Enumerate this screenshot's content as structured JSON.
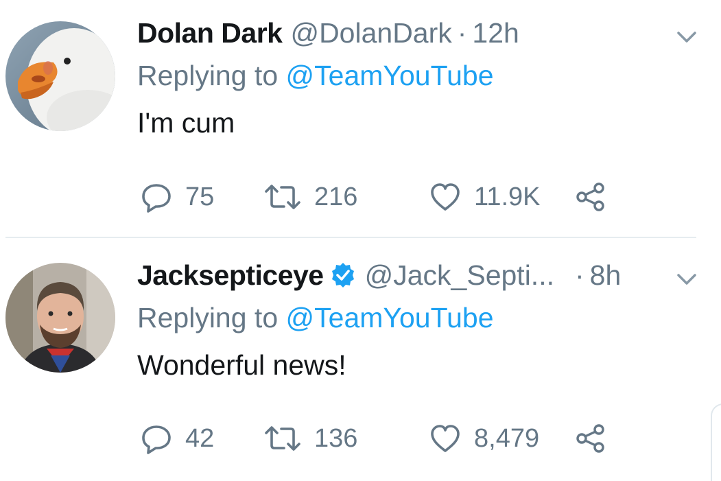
{
  "tweets": [
    {
      "name": "Dolan Dark",
      "verified": false,
      "handle": "@DolanDark",
      "separator": "·",
      "time": "12h",
      "replying_prefix": "Replying to ",
      "replying_to": "@TeamYouTube",
      "text": "I'm cum",
      "avatar_icon": "goose-avatar",
      "replies": "75",
      "retweets": "216",
      "likes": "11.9K"
    },
    {
      "name": "Jacksepticeye",
      "verified": true,
      "handle": "@Jack_Septi...",
      "separator": "·",
      "time": "8h",
      "replying_prefix": "Replying to ",
      "replying_to": "@TeamYouTube",
      "text": "Wonderful news!",
      "avatar_icon": "person-avatar",
      "replies": "42",
      "retweets": "136",
      "likes": "8,479"
    }
  ],
  "colors": {
    "primary_text": "#14171a",
    "secondary_text": "#657786",
    "link": "#1da1f2",
    "divider": "#e6ecf0"
  },
  "icons": [
    "reply-icon",
    "retweet-icon",
    "like-icon",
    "share-icon",
    "chevron-down-icon",
    "verified-badge-icon"
  ]
}
